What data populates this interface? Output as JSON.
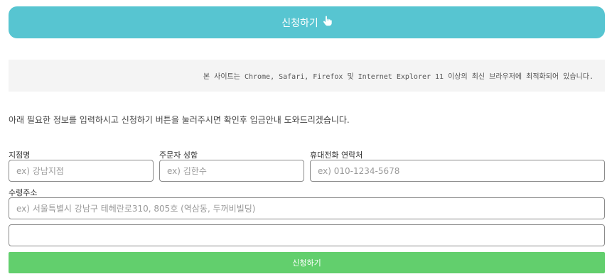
{
  "header": {
    "apply_button_label": "신청하기"
  },
  "notice": {
    "text": "본 사이트는 Chrome, Safari, Firefox 및 Internet Explorer 11 이상의 최신 브라우저에 최적화되어 있습니다."
  },
  "intro": {
    "text": "아래 필요한 정보를 입력하시고 신청하기 버튼을 눌러주시면 확인후 입금안내 도와드리겠습니다."
  },
  "form": {
    "branch": {
      "label": "지점명",
      "placeholder": "ex) 강남지점",
      "value": ""
    },
    "orderer_name": {
      "label": "주문자 성함",
      "placeholder": "ex) 김한수",
      "value": ""
    },
    "phone": {
      "label": "휴대전화 연락처",
      "placeholder": "ex) 010-1234-5678",
      "value": ""
    },
    "address": {
      "label": "수령주소",
      "placeholder": "ex) 서울특별시 강남구 테헤란로310, 805호 (역삼동, 두꺼비빌딩)",
      "value": ""
    },
    "address_detail": {
      "placeholder": "",
      "value": ""
    },
    "submit_label": "신청하기"
  },
  "icons": {
    "apply_button_icon": "hand-pointer-icon"
  },
  "colors": {
    "top_button": "#57c5d1",
    "submit_button": "#62cf6d",
    "notice_bg": "#f4f4f4"
  }
}
